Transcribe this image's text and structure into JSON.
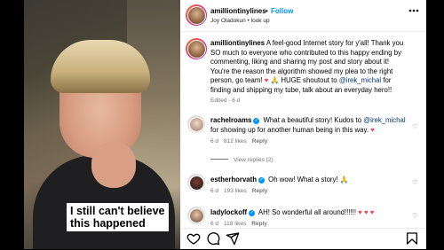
{
  "header": {
    "username": "amilliontinylines",
    "separator": "•",
    "follow_label": "Follow",
    "subtitle": "Joy Oladokun • look up",
    "more_icon": "more-horizontal-icon"
  },
  "video": {
    "caption_line1": "I still can't believe",
    "caption_line2": "this happened"
  },
  "post": {
    "username": "amilliontinylines",
    "text_part1": " A feel-good Internet story for y'all! Thank you SO much to everyone who contributed to this happy ending by commenting, liking and sharing my post and story about it! You're the reason the algorithm showed my plea to the right person, go team! ",
    "text_emoji": "♥ 🙏",
    "text_part2": " HUGE shoutout to ",
    "mention": "@irek_michal",
    "text_part3": " for finding and shipping my tube, talk about an everyday hero!!",
    "edited": "Edited · 6 d"
  },
  "comments": [
    {
      "username": "rachelroams",
      "verified": true,
      "text_before": " What a beautiful story! Kudos to ",
      "mention": "@irek_michal",
      "text_after": " for showing up for another human being in this way. ",
      "emoji": "♥",
      "age": "6 d",
      "likes": "812 likes",
      "reply": "Reply",
      "view_replies": "View replies (2)"
    },
    {
      "username": "estherhorvath",
      "verified": true,
      "text": " Oh wow! What a story! 🙏",
      "age": "6 d",
      "likes": "193 likes",
      "reply": "Reply"
    },
    {
      "username": "ladylockoff",
      "verified": true,
      "text": " AH! So wonderful all around!!!!!! ",
      "emoji": "♥ ♥ ♥",
      "age": "6 d",
      "likes": "118 likes",
      "reply": "Reply"
    }
  ],
  "actions": {
    "like_icon": "heart-icon",
    "comment_icon": "comment-icon",
    "share_icon": "share-icon",
    "save_icon": "bookmark-icon"
  },
  "colors": {
    "link_blue": "#0095f6",
    "mention": "#00376b",
    "heart_red": "#ed4956",
    "muted": "#737373"
  }
}
